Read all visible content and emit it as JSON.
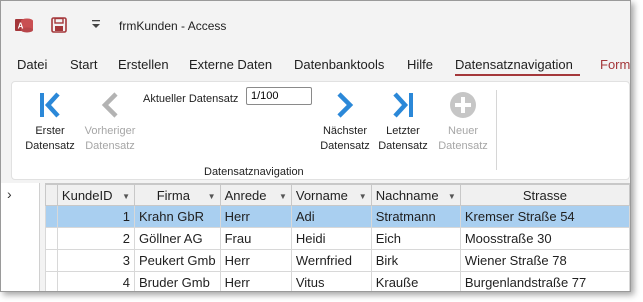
{
  "window": {
    "title": "frmKunden  -  Access"
  },
  "tabs": [
    "Datei",
    "Start",
    "Erstellen",
    "Externe Daten",
    "Datenbanktools",
    "Hilfe",
    "Datensatznavigation",
    "Form"
  ],
  "ribbon": {
    "first_button": {
      "line1": "Erster",
      "line2": "Datensatz"
    },
    "previous_button": {
      "line1": "Vorheriger",
      "line2": "Datensatz"
    },
    "current_record_label": "Aktueller Datensatz",
    "current_record_value": "1/100",
    "next_button": {
      "line1": "Nächster",
      "line2": "Datensatz"
    },
    "last_button": {
      "line1": "Letzter",
      "line2": "Datensatz"
    },
    "new_button": {
      "line1": "Neuer",
      "line2": "Datensatz"
    },
    "group_label": "Datensatznavigation"
  },
  "nav_pane": {
    "toggle": "›"
  },
  "grid": {
    "columns": [
      "KundeID",
      "Firma",
      "Anrede",
      "Vorname",
      "Nachname",
      "Strasse"
    ],
    "rows": [
      [
        "1",
        "Krahn GbR",
        "Herr",
        "Adi",
        "Stratmann",
        "Kremser Straße 54"
      ],
      [
        "2",
        "Göllner AG",
        "Frau",
        "Heidi",
        "Eich",
        "Moosstraße 30"
      ],
      [
        "3",
        "Peukert Gmb",
        "Herr",
        "Wernfried",
        "Birk",
        "Wiener Straße 78"
      ],
      [
        "4",
        "Bruder Gmb",
        "Herr",
        "Vitus",
        "Kraußе",
        "Burgenlandstraße 77"
      ]
    ],
    "selected_row": 0
  },
  "colors": {
    "accent": "#a4373a",
    "nav_arrow": "#2b88d8",
    "selection": "#a9cff0"
  }
}
